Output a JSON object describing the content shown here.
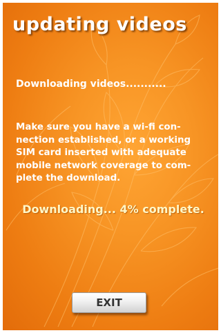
{
  "header": {
    "title": "updating videos"
  },
  "status": {
    "downloading_line": "Downloading videos...........",
    "instructions": [
      "Make sure you have a wi-fi con-",
      "nection established, or a working",
      "SIM card inserted with adequate",
      "mobile network coverage to com-",
      "plete the download."
    ],
    "progress_text": "Downloading... 4% complete.",
    "progress_percent": 4
  },
  "actions": {
    "exit_label": "EXIT"
  },
  "colors": {
    "background": "#f28a1e",
    "text": "#ffffff",
    "progress_text": "#fff7c8",
    "button": "#eeeeee"
  },
  "icons": {
    "background_decoration": "wheat-stalk-line-art"
  }
}
